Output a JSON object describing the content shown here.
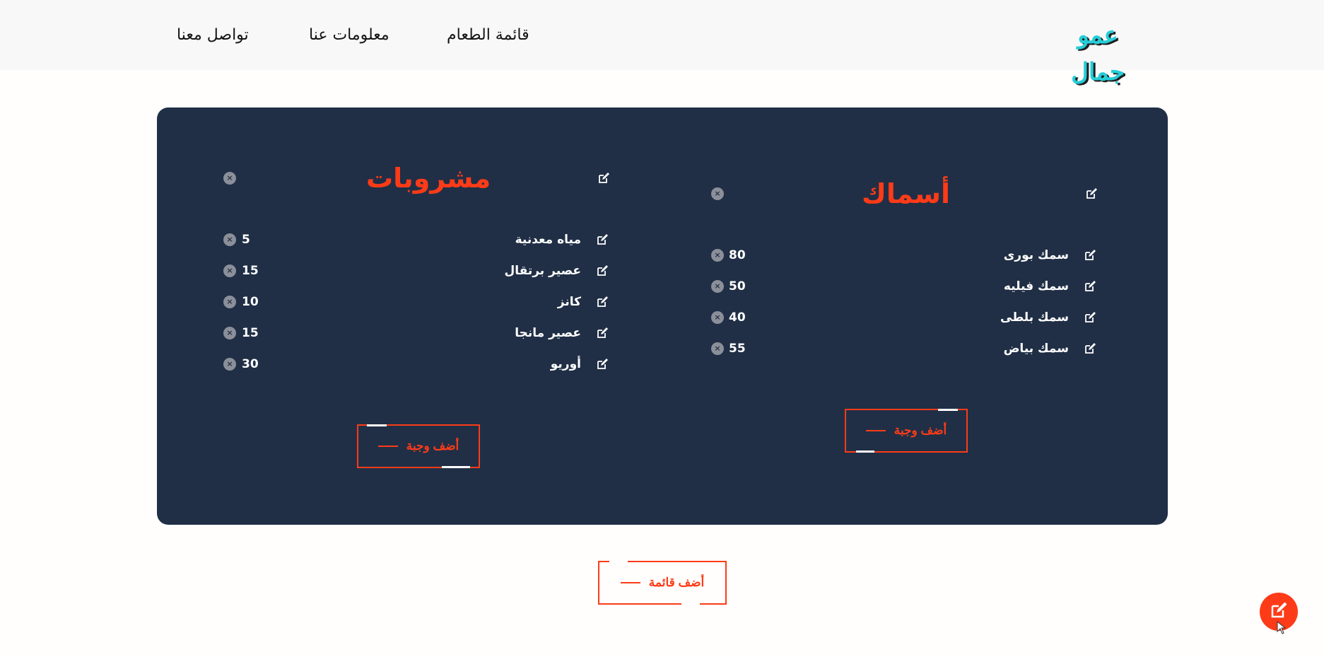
{
  "brand": {
    "logo_text": "عمو جمال"
  },
  "nav": {
    "menu": "قائمة الطعام",
    "about": "معلومات عنا",
    "contact": "تواصل معنا"
  },
  "sections": [
    {
      "title": "أسماك",
      "items": [
        {
          "name": "سمك بورى",
          "price": "80"
        },
        {
          "name": "سمك فيليه",
          "price": "50"
        },
        {
          "name": "سمك بلطى",
          "price": "40"
        },
        {
          "name": "سمك بياض",
          "price": "55"
        }
      ],
      "add_label": "أضف وجبة"
    },
    {
      "title": "مشروبات",
      "items": [
        {
          "name": "مياه معدنية",
          "price": "5"
        },
        {
          "name": "عصير برتقال",
          "price": "15"
        },
        {
          "name": "كانز",
          "price": "10"
        },
        {
          "name": "عصير مانجا",
          "price": "15"
        },
        {
          "name": "أوريو",
          "price": "30"
        }
      ],
      "add_label": "أضف وجبة"
    }
  ],
  "add_menu_label": "أضف قائمة",
  "colors": {
    "accent": "#fd3b18",
    "board": "#202f46",
    "logo": "#25cdd8",
    "navbar": "#f8f8f9"
  },
  "icons": {
    "edit": "edit-icon",
    "delete": "close-circle-icon",
    "fab": "edit-icon"
  }
}
